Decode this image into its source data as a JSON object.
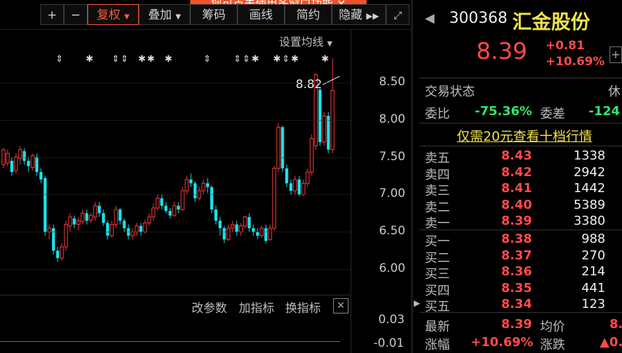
{
  "toolbar": {
    "plus": "+",
    "minus": "−",
    "fuquan": "复权",
    "diejia": "叠加",
    "chouma": "筹码",
    "huaxian": "画线",
    "jianyue": "简约",
    "yincang": "隐藏",
    "tip": "您可点击使用多窗口功能"
  },
  "chart": {
    "set_ma": "设置均线",
    "price_annotation": "8.82",
    "y_labels": [
      "8.50",
      "8.00",
      "7.50",
      "7.00",
      "6.50",
      "6.00"
    ],
    "sub_labels": [
      "0.03",
      "-0.01"
    ],
    "sub_toolbar": {
      "gaicanshu": "改参数",
      "jiazhibiao": "加指标",
      "huanzhibiao": "换指标"
    }
  },
  "chart_data": {
    "type": "candlestick",
    "ylim": [
      5.8,
      8.95
    ],
    "candles": [
      [
        7.4,
        7.6,
        7.35,
        7.62
      ],
      [
        7.42,
        7.55,
        7.38,
        7.6
      ],
      [
        7.45,
        7.3,
        7.25,
        7.5
      ],
      [
        7.32,
        7.5,
        7.28,
        7.55
      ],
      [
        7.48,
        7.6,
        7.4,
        7.65
      ],
      [
        7.58,
        7.45,
        7.4,
        7.62
      ],
      [
        7.45,
        7.38,
        7.3,
        7.5
      ],
      [
        7.36,
        7.52,
        7.32,
        7.55
      ],
      [
        7.5,
        7.3,
        7.25,
        7.55
      ],
      [
        7.3,
        7.2,
        7.15,
        7.35
      ],
      [
        7.22,
        6.5,
        6.45,
        7.25
      ],
      [
        6.5,
        6.55,
        6.4,
        6.6
      ],
      [
        6.55,
        6.25,
        6.2,
        6.6
      ],
      [
        6.25,
        6.15,
        6.1,
        6.3
      ],
      [
        6.15,
        6.3,
        6.12,
        6.35
      ],
      [
        6.3,
        6.6,
        6.25,
        6.65
      ],
      [
        6.58,
        6.7,
        6.5,
        6.75
      ],
      [
        6.68,
        6.6,
        6.55,
        6.72
      ],
      [
        6.6,
        6.65,
        6.52,
        6.7
      ],
      [
        6.64,
        6.75,
        6.6,
        6.8
      ],
      [
        6.75,
        6.65,
        6.6,
        6.8
      ],
      [
        6.66,
        6.72,
        6.62,
        6.76
      ],
      [
        6.7,
        6.85,
        6.65,
        6.9
      ],
      [
        6.85,
        6.75,
        6.7,
        6.9
      ],
      [
        6.75,
        6.62,
        6.58,
        6.8
      ],
      [
        6.62,
        6.45,
        6.4,
        6.65
      ],
      [
        6.45,
        6.6,
        6.42,
        6.65
      ],
      [
        6.6,
        6.8,
        6.55,
        6.85
      ],
      [
        6.8,
        6.65,
        6.6,
        6.82
      ],
      [
        6.65,
        6.55,
        6.5,
        6.68
      ],
      [
        6.55,
        6.45,
        6.4,
        6.6
      ],
      [
        6.45,
        6.5,
        6.4,
        6.55
      ],
      [
        6.5,
        6.58,
        6.45,
        6.62
      ],
      [
        6.58,
        6.5,
        6.45,
        6.62
      ],
      [
        6.5,
        6.62,
        6.48,
        6.66
      ],
      [
        6.62,
        6.7,
        6.58,
        6.75
      ],
      [
        6.7,
        6.82,
        6.65,
        6.88
      ],
      [
        6.82,
        6.95,
        6.78,
        7.0
      ],
      [
        6.95,
        6.85,
        6.8,
        7.0
      ],
      [
        6.85,
        6.78,
        6.75,
        6.9
      ],
      [
        6.78,
        6.72,
        6.68,
        6.82
      ],
      [
        6.72,
        6.85,
        6.7,
        6.9
      ],
      [
        6.85,
        6.8,
        6.75,
        6.9
      ],
      [
        6.8,
        7.05,
        6.78,
        7.1
      ],
      [
        7.05,
        7.2,
        7.0,
        7.25
      ],
      [
        7.2,
        7.15,
        7.1,
        7.28
      ],
      [
        7.15,
        6.95,
        6.9,
        7.18
      ],
      [
        6.95,
        7.05,
        6.92,
        7.1
      ],
      [
        7.05,
        7.15,
        7.0,
        7.2
      ],
      [
        7.15,
        7.1,
        7.02,
        7.22
      ],
      [
        7.1,
        6.8,
        6.75,
        7.12
      ],
      [
        6.8,
        6.65,
        6.6,
        6.85
      ],
      [
        6.65,
        6.55,
        6.45,
        6.7
      ],
      [
        6.55,
        6.4,
        6.35,
        6.58
      ],
      [
        6.4,
        6.55,
        6.38,
        6.6
      ],
      [
        6.55,
        6.6,
        6.5,
        6.65
      ],
      [
        6.6,
        6.5,
        6.45,
        6.65
      ],
      [
        6.5,
        6.58,
        6.45,
        6.62
      ],
      [
        6.58,
        6.7,
        6.55,
        6.72
      ],
      [
        6.7,
        6.55,
        6.5,
        6.75
      ],
      [
        6.55,
        6.5,
        6.45,
        6.6
      ],
      [
        6.5,
        6.45,
        6.4,
        6.55
      ],
      [
        6.45,
        6.55,
        6.42,
        6.58
      ],
      [
        6.55,
        6.38,
        6.35,
        6.6
      ],
      [
        6.4,
        6.55,
        6.38,
        6.6
      ],
      [
        6.55,
        7.35,
        6.52,
        7.38
      ],
      [
        7.35,
        7.9,
        7.3,
        7.95
      ],
      [
        7.9,
        7.35,
        7.3,
        7.92
      ],
      [
        7.35,
        7.15,
        7.1,
        7.4
      ],
      [
        7.15,
        7.05,
        7.0,
        7.2
      ],
      [
        7.05,
        7.2,
        7.0,
        7.25
      ],
      [
        7.2,
        7.0,
        6.98,
        7.25
      ],
      [
        7.0,
        7.15,
        6.98,
        7.2
      ],
      [
        7.15,
        7.3,
        7.1,
        7.35
      ],
      [
        7.3,
        7.75,
        7.25,
        7.8
      ],
      [
        7.65,
        8.6,
        7.6,
        8.62
      ],
      [
        8.4,
        7.7,
        7.65,
        8.42
      ],
      [
        7.7,
        8.05,
        7.65,
        8.1
      ],
      [
        8.05,
        7.6,
        7.55,
        8.1
      ],
      [
        7.6,
        8.39,
        7.55,
        8.82
      ]
    ]
  },
  "quote": {
    "code": "300368",
    "name": "汇金股份",
    "price": "8.39",
    "change": "+0.81",
    "change_pct": "+10.69%",
    "trade_status_label": "交易状态",
    "trade_status": "休",
    "weibi_label": "委比",
    "weibi": "-75.36%",
    "weicha_label": "委差",
    "weicha": "-124",
    "promo": "仅需20元查看十档行情",
    "asks": [
      {
        "label": "卖五",
        "price": "8.43",
        "vol": "1338"
      },
      {
        "label": "卖四",
        "price": "8.42",
        "vol": "2942"
      },
      {
        "label": "卖三",
        "price": "8.41",
        "vol": "1442"
      },
      {
        "label": "卖二",
        "price": "8.40",
        "vol": "5389"
      },
      {
        "label": "卖一",
        "price": "8.39",
        "vol": "3380"
      }
    ],
    "bids": [
      {
        "label": "买一",
        "price": "8.38",
        "vol": "988"
      },
      {
        "label": "买二",
        "price": "8.37",
        "vol": "270"
      },
      {
        "label": "买三",
        "price": "8.36",
        "vol": "214"
      },
      {
        "label": "买四",
        "price": "8.35",
        "vol": "441"
      },
      {
        "label": "买五",
        "price": "8.34",
        "vol": "123"
      }
    ],
    "latest_label": "最新",
    "latest": "8.39",
    "avg_label": "均价",
    "avg": "8.",
    "zf_label": "涨幅",
    "zf": "+10.69%",
    "zd_label": "涨跌",
    "zd": "▲0."
  }
}
